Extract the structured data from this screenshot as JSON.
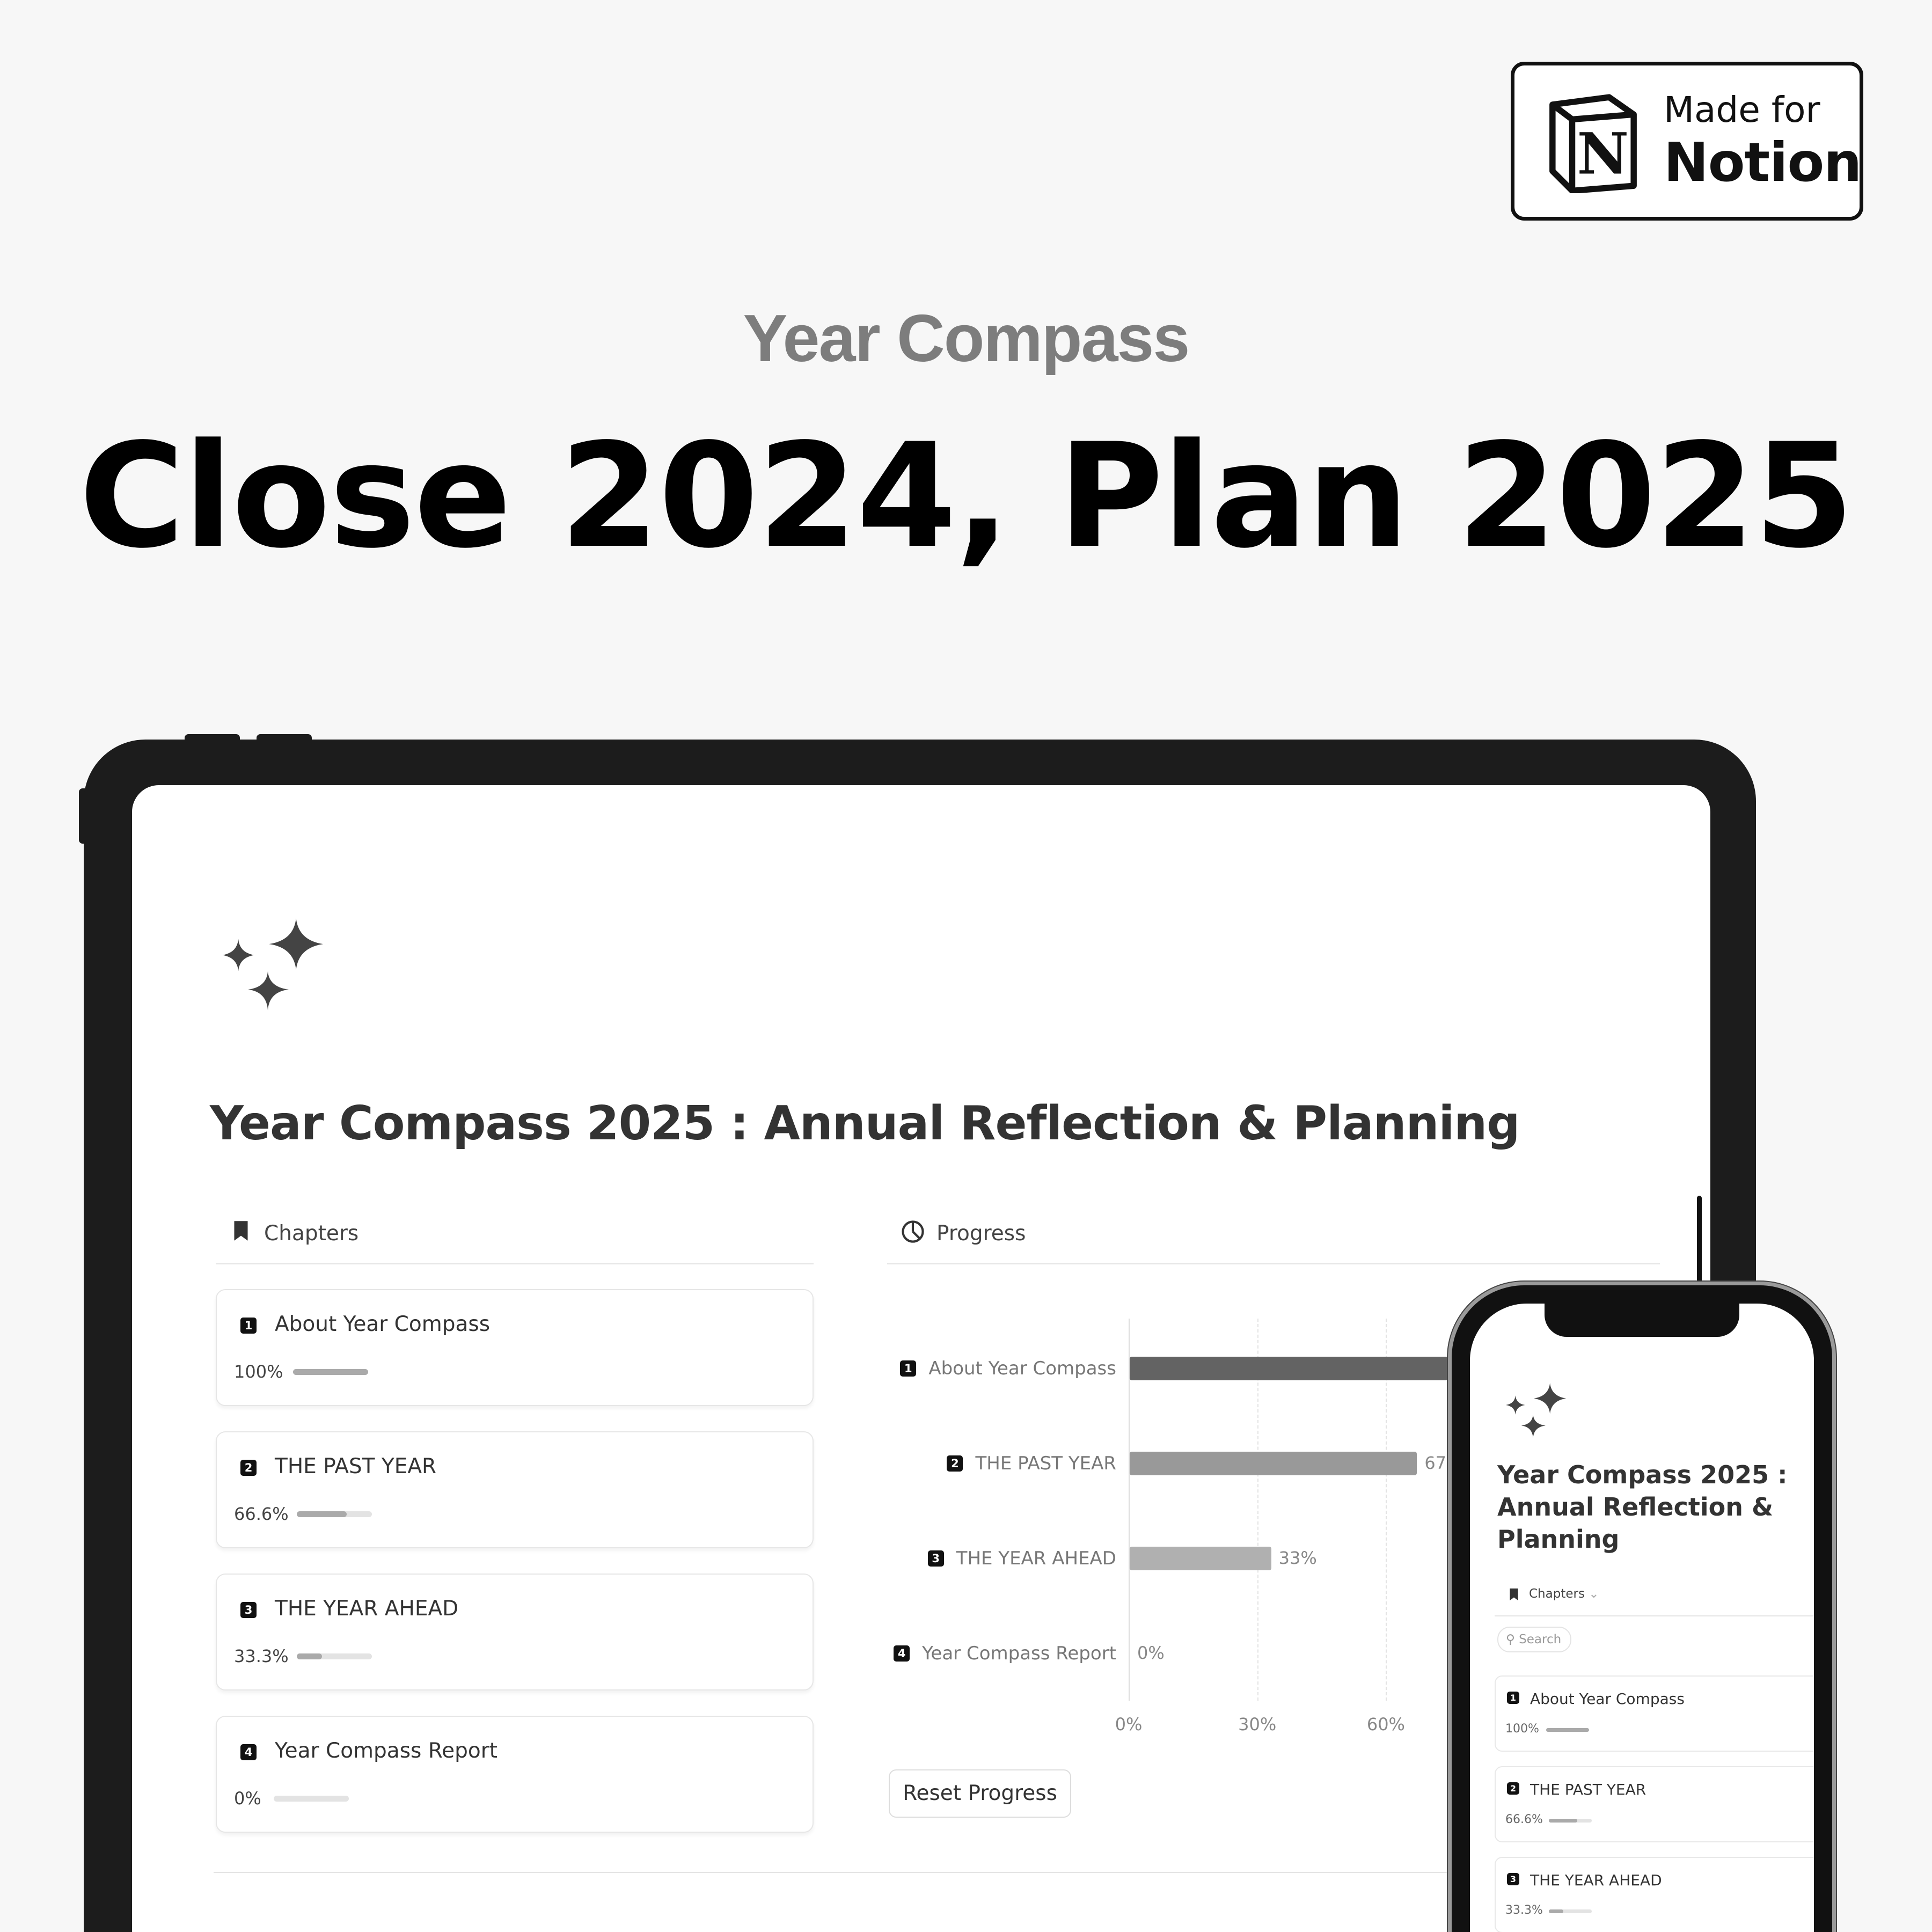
{
  "badge": {
    "line1": "Made for",
    "line2": "Notion",
    "logo_letter": "N"
  },
  "hero": {
    "kicker": "Year Compass",
    "headline": "Close 2024, Plan 2025"
  },
  "page": {
    "icon": "sparkles-icon",
    "title": "Year Compass 2025 : Annual Reflection & Planning",
    "chapters_header": "Chapters",
    "progress_header": "Progress",
    "reset_button": "Reset Progress",
    "chapters": [
      {
        "num": "1",
        "title": "About Year Compass",
        "percent_label": "100%",
        "progress": 100
      },
      {
        "num": "2",
        "title": "THE PAST YEAR",
        "percent_label": "66.6%",
        "progress": 66.6
      },
      {
        "num": "3",
        "title": "THE YEAR AHEAD",
        "percent_label": "33.3%",
        "progress": 33.3
      },
      {
        "num": "4",
        "title": "Year Compass Report",
        "percent_label": "0%",
        "progress": 0
      }
    ]
  },
  "chart_data": {
    "type": "bar",
    "orientation": "horizontal",
    "categories": [
      "About Year Compass",
      "THE PAST YEAR",
      "THE YEAR AHEAD",
      "Year Compass Report"
    ],
    "category_numbers": [
      "1",
      "2",
      "3",
      "4"
    ],
    "values": [
      100,
      67,
      33,
      0
    ],
    "value_labels": [
      null,
      "67%",
      "33%",
      "0%"
    ],
    "xlim": [
      0,
      100
    ],
    "xticks": [
      "0%",
      "30%",
      "60%"
    ],
    "xtick_values": [
      0,
      30,
      60
    ],
    "grid": true,
    "colors": [
      "#636363",
      "#999999",
      "#b0b0b0",
      "#cccccc"
    ]
  },
  "phone": {
    "title_lines": [
      "Year Compass 2025 :",
      "Annual Reflection &",
      "Planning"
    ],
    "chapters_header": "Chapters",
    "search_placeholder": "Search",
    "chapters": [
      {
        "num": "1",
        "title": "About Year Compass",
        "percent_label": "100%",
        "progress": 100
      },
      {
        "num": "2",
        "title": "THE PAST YEAR",
        "percent_label": "66.6%",
        "progress": 66.6
      },
      {
        "num": "3",
        "title": "THE YEAR AHEAD",
        "percent_label": "33.3%",
        "progress": 33.3
      }
    ]
  }
}
